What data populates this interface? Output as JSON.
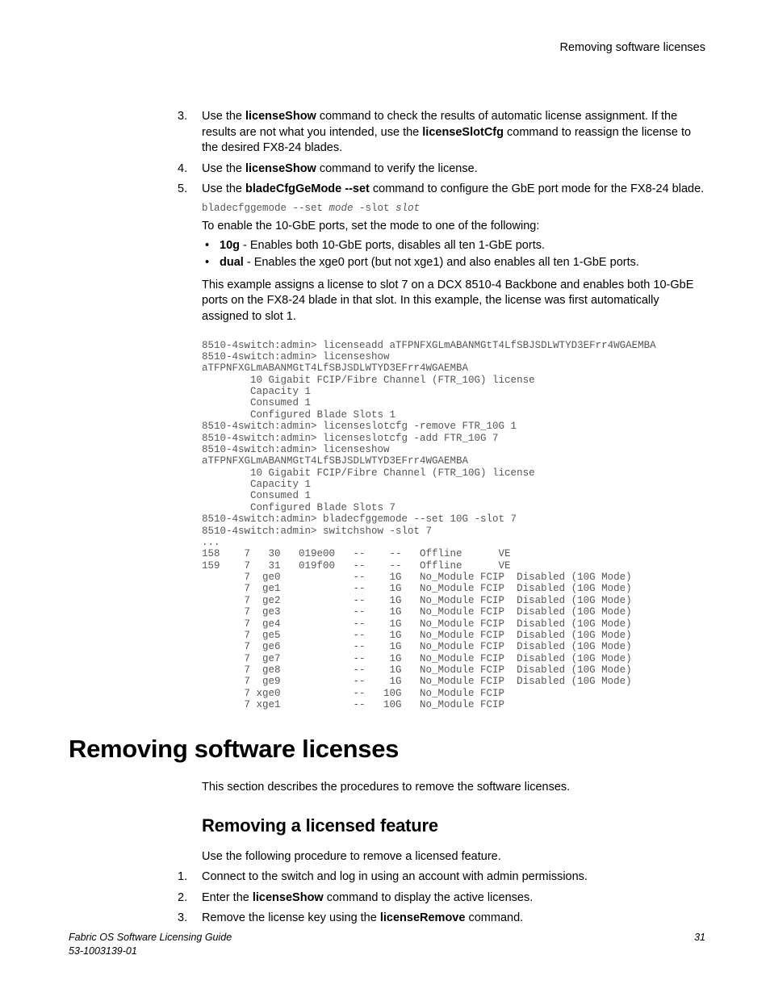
{
  "running_header": "Removing software licenses",
  "steps_a": {
    "s3": {
      "num": "3.",
      "pre": "Use the ",
      "cmd1": "licenseShow",
      "mid1": " command to check the results of automatic license assignment. If the results are not what you intended, use the ",
      "cmd2": "licenseSlotCfg",
      "post": " command to reassign the license to the desired FX8-24 blades."
    },
    "s4": {
      "num": "4.",
      "pre": "Use the ",
      "cmd": "licenseShow",
      "post": " command to verify the license."
    },
    "s5": {
      "num": "5.",
      "pre": "Use the ",
      "cmd": "bladeCfgGeMode --set",
      "post": " command to configure the GbE port mode for the FX8-24 blade."
    }
  },
  "code1": {
    "a": "bladecfggemode --set ",
    "mode": "mode",
    "b": " -slot ",
    "slot": "slot"
  },
  "para_enable": "To enable the 10-GbE ports, set the mode to one of the following:",
  "bullets": {
    "b1": {
      "term": "10g",
      "desc": " - Enables both 10-GbE ports, disables all ten 1-GbE ports."
    },
    "b2": {
      "term": "dual",
      "desc": " - Enables the xge0 port (but not xge1) and also enables all ten 1-GbE ports."
    }
  },
  "para_example": "This example assigns a license to slot 7 on a DCX 8510-4 Backbone and enables both 10-GbE ports on the FX8-24 blade in that slot. In this example, the license was first automatically assigned to slot 1.",
  "code2": "8510-4switch:admin> licenseadd aTFPNFXGLmABANMGtT4LfSBJSDLWTYD3EFrr4WGAEMBA\n8510-4switch:admin> licenseshow\naTFPNFXGLmABANMGtT4LfSBJSDLWTYD3EFrr4WGAEMBA\n        10 Gigabit FCIP/Fibre Channel (FTR_10G) license\n        Capacity 1\n        Consumed 1\n        Configured Blade Slots 1\n8510-4switch:admin> licenseslotcfg -remove FTR_10G 1\n8510-4switch:admin> licenseslotcfg -add FTR_10G 7\n8510-4switch:admin> licenseshow\naTFPNFXGLmABANMGtT4LfSBJSDLWTYD3EFrr4WGAEMBA\n        10 Gigabit FCIP/Fibre Channel (FTR_10G) license\n        Capacity 1\n        Consumed 1\n        Configured Blade Slots 7\n8510-4switch:admin> bladecfggemode --set 10G -slot 7\n8510-4switch:admin> switchshow -slot 7\n...\n158    7   30   019e00   --    --   Offline      VE\n159    7   31   019f00   --    --   Offline      VE\n       7  ge0            --    1G   No_Module FCIP  Disabled (10G Mode)\n       7  ge1            --    1G   No_Module FCIP  Disabled (10G Mode)\n       7  ge2            --    1G   No_Module FCIP  Disabled (10G Mode)\n       7  ge3            --    1G   No_Module FCIP  Disabled (10G Mode)\n       7  ge4            --    1G   No_Module FCIP  Disabled (10G Mode)\n       7  ge5            --    1G   No_Module FCIP  Disabled (10G Mode)\n       7  ge6            --    1G   No_Module FCIP  Disabled (10G Mode)\n       7  ge7            --    1G   No_Module FCIP  Disabled (10G Mode)\n       7  ge8            --    1G   No_Module FCIP  Disabled (10G Mode)\n       7  ge9            --    1G   No_Module FCIP  Disabled (10G Mode)\n       7 xge0            --   10G   No_Module FCIP\n       7 xge1            --   10G   No_Module FCIP",
  "h1": "Removing software licenses",
  "h1_body": "This section describes the procedures to remove the software licenses.",
  "h2": "Removing a licensed feature",
  "h2_body": "Use the following procedure to remove a licensed feature.",
  "steps_b": {
    "s1": {
      "num": "1.",
      "text": "Connect to the switch and log in using an account with admin permissions."
    },
    "s2": {
      "num": "2.",
      "pre": "Enter the ",
      "cmd": "licenseShow",
      "post": " command to display the active licenses."
    },
    "s3": {
      "num": "3.",
      "pre": "Remove the license key using the ",
      "cmd": "licenseRemove",
      "post": " command."
    }
  },
  "footer": {
    "title": "Fabric OS Software Licensing Guide",
    "docnum": "53-1003139-01",
    "page": "31"
  }
}
